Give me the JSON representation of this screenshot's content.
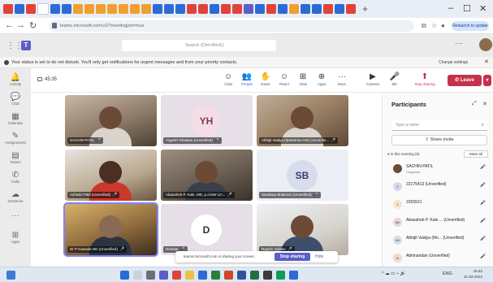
{
  "browser": {
    "url": "teams.microsoft.com/v2/?meetingjoin=true",
    "relaunch_label": "Relaunch to update",
    "win_min": "–",
    "win_max": "☐",
    "win_close": "✕",
    "new_tab": "+"
  },
  "teams": {
    "search_placeholder": "Search (Ctrl+Alt+E)",
    "more": "···"
  },
  "banner": {
    "text": "Your status is set to do not disturb. You'll only get notifications for urgent messages and from your priority contacts.",
    "change_label": "Change settings",
    "close": "✕"
  },
  "rail": {
    "items": [
      {
        "label": "Activity",
        "glyph": "🔔"
      },
      {
        "label": "Chat",
        "glyph": "💬"
      },
      {
        "label": "Calendar",
        "glyph": "▦"
      },
      {
        "label": "Assignments",
        "glyph": "✎"
      },
      {
        "label": "Teams",
        "glyph": "▤"
      },
      {
        "label": "Calls",
        "glyph": "✆"
      },
      {
        "label": "OneDrive",
        "glyph": "☁"
      },
      {
        "label": "More",
        "glyph": "···"
      },
      {
        "label": "Apps",
        "glyph": "⊞"
      }
    ]
  },
  "toolbar": {
    "timer": "45:35",
    "buttons": [
      {
        "label": "Chat",
        "glyph": "☺"
      },
      {
        "label": "People",
        "glyph": "👥"
      },
      {
        "label": "Raise",
        "glyph": "✋"
      },
      {
        "label": "React",
        "glyph": "☺"
      },
      {
        "label": "View",
        "glyph": "⊞"
      },
      {
        "label": "Apps",
        "glyph": "⊕"
      },
      {
        "label": "More",
        "glyph": "···"
      },
      {
        "label": "Camera",
        "glyph": "▶"
      },
      {
        "label": "Mic",
        "glyph": "🎤"
      },
      {
        "label": "Stop sharing",
        "glyph": "⬆"
      }
    ],
    "leave_label": "Leave",
    "leave_chevron": "▾"
  },
  "stage": {
    "tiles": [
      {
        "name": "SACHIN PATIL",
        "mic": "🎤",
        "kind": "photo"
      },
      {
        "name": "Yogesh Ghadam (Unverified)",
        "mic": "🎤",
        "kind": "initials",
        "initials": "YH",
        "bg": "#f4dde6",
        "fg": "#7b3a52"
      },
      {
        "name": "Abhijit Vaidya (Mahatma-CIB) (Unverifie...",
        "mic": "🎤",
        "kind": "photo"
      },
      {
        "name": "Ashwini Patil (Unverified)",
        "mic": "🎤",
        "kind": "photo"
      },
      {
        "name": "Abasaheb P. Kale, MD, p.d.NW Lin...",
        "mic": "🎤",
        "kind": "photo"
      },
      {
        "name": "Sandeep Bhalerao (Unverified)",
        "mic": "🎤",
        "kind": "initials",
        "initials": "SB",
        "bg": "#d9dcea",
        "fg": "#2f3f7a"
      },
      {
        "name": "Dr P Gawade BD (Unverified)",
        "mic": "🎤",
        "kind": "photo"
      },
      {
        "name": "Deolate",
        "mic": "🎤",
        "kind": "initials",
        "initials": "D",
        "bg": "#ffffff",
        "fg": "#333333"
      },
      {
        "name": "Rajesh Jadhav",
        "mic": "🎤",
        "kind": "photo"
      }
    ],
    "share_toast": {
      "text": "teams.microsoft.com is sharing your screen.",
      "stop_label": "Stop sharing",
      "hide_label": "Hide"
    }
  },
  "participants": {
    "title": "Participants",
    "pin": "⤢",
    "close": "✕",
    "search_placeholder": "Type a name",
    "search_icon": "⌕",
    "share_invite": "Share invite",
    "share_icon": "⇪",
    "in_meeting": "▾ In this meeting (8)",
    "mute_all": "Mute all",
    "people": [
      {
        "name": "SACHIN PATIL",
        "role": "Organizer",
        "initials": "",
        "color": "#6b4b35",
        "mic": "🎤"
      },
      {
        "name": "22175413 (Unverified)",
        "role": "",
        "initials": "2",
        "color": "#d7d9f2",
        "mic": "🎤"
      },
      {
        "name": "2265521",
        "role": "",
        "initials": "2",
        "color": "#f6e6c8",
        "mic": "🎤"
      },
      {
        "name": "Abasaheb P. Kale ... (Unverified)",
        "role": "",
        "initials": "AK",
        "color": "#e8d6dd",
        "mic": "🎤"
      },
      {
        "name": "Abhijit Vaidya (Mo... (Unverified)",
        "role": "",
        "initials": "AV",
        "color": "#d9dcea",
        "mic": "🎤"
      },
      {
        "name": "Abhinandan (Unverified)",
        "role": "",
        "initials": "A",
        "color": "#f2d9d2",
        "mic": "🎤"
      }
    ]
  },
  "taskbar": {
    "time": "16:42",
    "date": "21-03-2024",
    "lang": "ENG",
    "tray": "^ ☁ ▭ ⌁ 🔊"
  }
}
